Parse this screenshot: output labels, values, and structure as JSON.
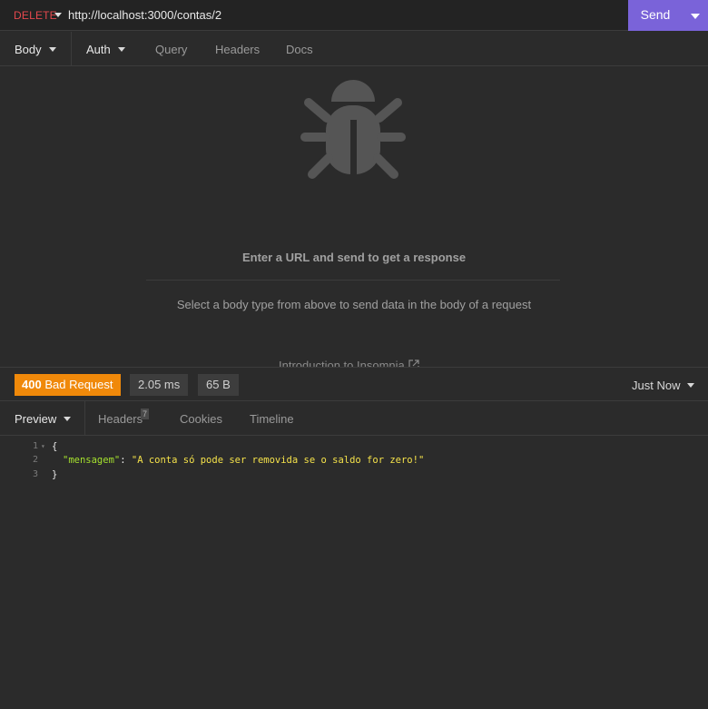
{
  "request": {
    "method": "DELETE",
    "url": "http://localhost:3000/contas/2",
    "send_label": "Send",
    "tabs": [
      "Body",
      "Auth",
      "Query",
      "Headers",
      "Docs"
    ]
  },
  "empty_state": {
    "title": "Enter a URL and send to get a response",
    "subtitle": "Select a body type from above to send data in the body of a request",
    "link": "Introduction to Insomnia"
  },
  "response": {
    "status_code": "400",
    "status_text": "Bad Request",
    "time": "2.05 ms",
    "size": "65 B",
    "timestamp": "Just Now",
    "tabs": [
      "Preview",
      "Headers",
      "Cookies",
      "Timeline"
    ],
    "headers_count": "7",
    "body_lines": {
      "l1": {
        "num": "1",
        "text": "{"
      },
      "l2": {
        "num": "2",
        "key": "\"mensagem\"",
        "sep": ": ",
        "value": "\"A conta só pode ser removida se o saldo for zero!\""
      },
      "l3": {
        "num": "3",
        "text": "}"
      }
    }
  },
  "colors": {
    "method": "#e5484d",
    "send": "#7a63d9",
    "status_badge": "#f0890a",
    "json_key": "#a6e22e",
    "json_string": "#f5e24a"
  },
  "icons": [
    "method-caret-icon",
    "send-dropdown-icon",
    "bug-icon",
    "external-link-icon",
    "chevron-down-icon"
  ]
}
